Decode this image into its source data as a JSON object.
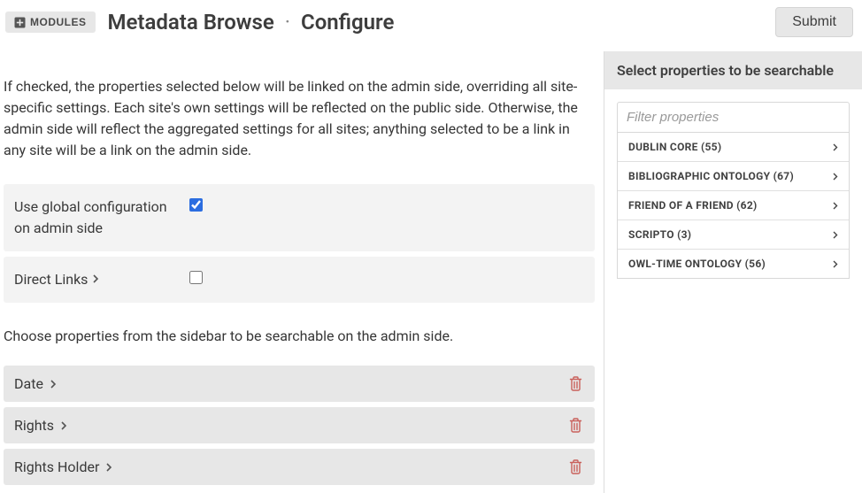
{
  "header": {
    "modules_label": "MODULES",
    "title_main": "Metadata Browse",
    "title_sub": "Configure",
    "submit_label": "Submit"
  },
  "intro_text": "If checked, the properties selected below will be linked on the admin side, overriding all site-specific settings. Each site's own settings will be reflected on the public side. Otherwise, the admin side will reflect the aggregated settings for all sites; anything selected to be a link in any site will be a link on the admin side.",
  "fields": {
    "global_config_label": "Use global configuration on admin side",
    "global_config_checked": true,
    "direct_links_label": "Direct Links",
    "direct_links_checked": false
  },
  "sub_intro_text": "Choose properties from the sidebar to be searchable on the admin side.",
  "selected_properties": [
    {
      "label": "Date"
    },
    {
      "label": "Rights"
    },
    {
      "label": "Rights Holder"
    }
  ],
  "sidebar": {
    "title": "Select properties to be searchable",
    "filter_placeholder": "Filter properties",
    "vocabularies": [
      {
        "label": "DUBLIN CORE (55)"
      },
      {
        "label": "BIBLIOGRAPHIC ONTOLOGY (67)"
      },
      {
        "label": "FRIEND OF A FRIEND (62)"
      },
      {
        "label": "SCRIPTO (3)"
      },
      {
        "label": "OWL-TIME ONTOLOGY (56)"
      }
    ]
  },
  "icons": {
    "plus": "plus-square-icon",
    "chevron_right": "chevron-right-icon",
    "trash": "trash-icon"
  }
}
